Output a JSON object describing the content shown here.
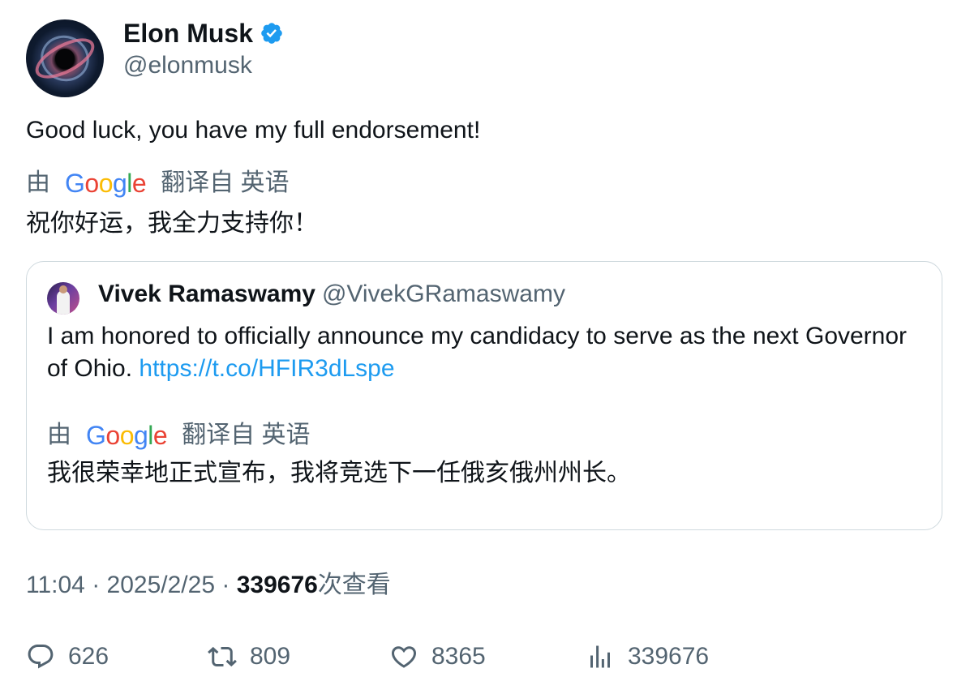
{
  "author": {
    "name": "Elon Musk",
    "handle": "@elonmusk",
    "verified_color": "#1d9bf0"
  },
  "tweet": {
    "text": "Good luck, you have my full endorsement!",
    "translation": {
      "prefix": "由",
      "provider": "Google",
      "suffix": "翻译自 英语",
      "text": "祝你好运，我全力支持你！"
    }
  },
  "quote": {
    "name": "Vivek Ramaswamy",
    "handle": "@VivekGRamaswamy",
    "text": "I am honored to officially announce my candidacy to serve as the next Governor of Ohio.",
    "link": "https://t.co/HFIR3dLspe",
    "translation": {
      "prefix": "由",
      "provider": "Google",
      "suffix": "翻译自 英语",
      "text": "我很荣幸地正式宣布，我将竞选下一任俄亥俄州州长。"
    }
  },
  "meta": {
    "time": "11:04",
    "separator": "·",
    "date": "2025/2/25",
    "views_count": "339676",
    "views_label": "次查看"
  },
  "actions": {
    "replies": "626",
    "retweets": "809",
    "likes": "8365",
    "views": "339676"
  },
  "colors": {
    "text_primary": "#0f1419",
    "text_secondary": "#536471",
    "link": "#1d9bf0",
    "border": "#cfd9de"
  }
}
